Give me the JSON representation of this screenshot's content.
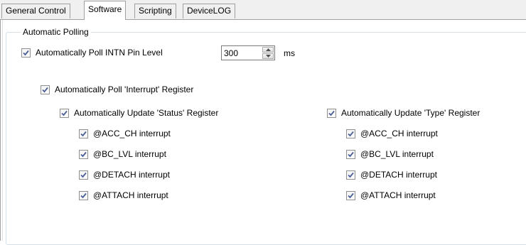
{
  "tabs": [
    {
      "label": "General Control",
      "active": false
    },
    {
      "label": "Software",
      "active": true
    },
    {
      "label": "Scripting",
      "active": false
    },
    {
      "label": "DeviceLOG",
      "active": false
    }
  ],
  "group": {
    "title": "Automatic Polling"
  },
  "poll_intn": {
    "label": "Automatically Poll INTN Pin Level",
    "checked": true
  },
  "interval": {
    "value": "300",
    "unit": "ms"
  },
  "poll_interrupt": {
    "label": "Automatically Poll 'Interrupt' Register",
    "checked": true
  },
  "status_group": {
    "label": "Automatically Update 'Status' Register",
    "checked": true,
    "items": [
      {
        "label": "@ACC_CH interrupt",
        "checked": true
      },
      {
        "label": "@BC_LVL interrupt",
        "checked": true
      },
      {
        "label": "@DETACH interrupt",
        "checked": true
      },
      {
        "label": "@ATTACH interrupt",
        "checked": true
      }
    ]
  },
  "type_group": {
    "label": "Automatically Update 'Type' Register",
    "checked": true,
    "items": [
      {
        "label": "@ACC_CH interrupt",
        "checked": true
      },
      {
        "label": "@BC_LVL interrupt",
        "checked": true
      },
      {
        "label": "@DETACH interrupt",
        "checked": true
      },
      {
        "label": "@ATTACH interrupt",
        "checked": true
      }
    ]
  },
  "colors": {
    "checkmark": "#4a5f97",
    "tab_border": "#a0a0a0",
    "groupbox_border": "#d5dfe5"
  },
  "icons": {
    "check": "check-icon",
    "spin_up": "arrow-up-icon",
    "spin_down": "arrow-down-icon"
  }
}
